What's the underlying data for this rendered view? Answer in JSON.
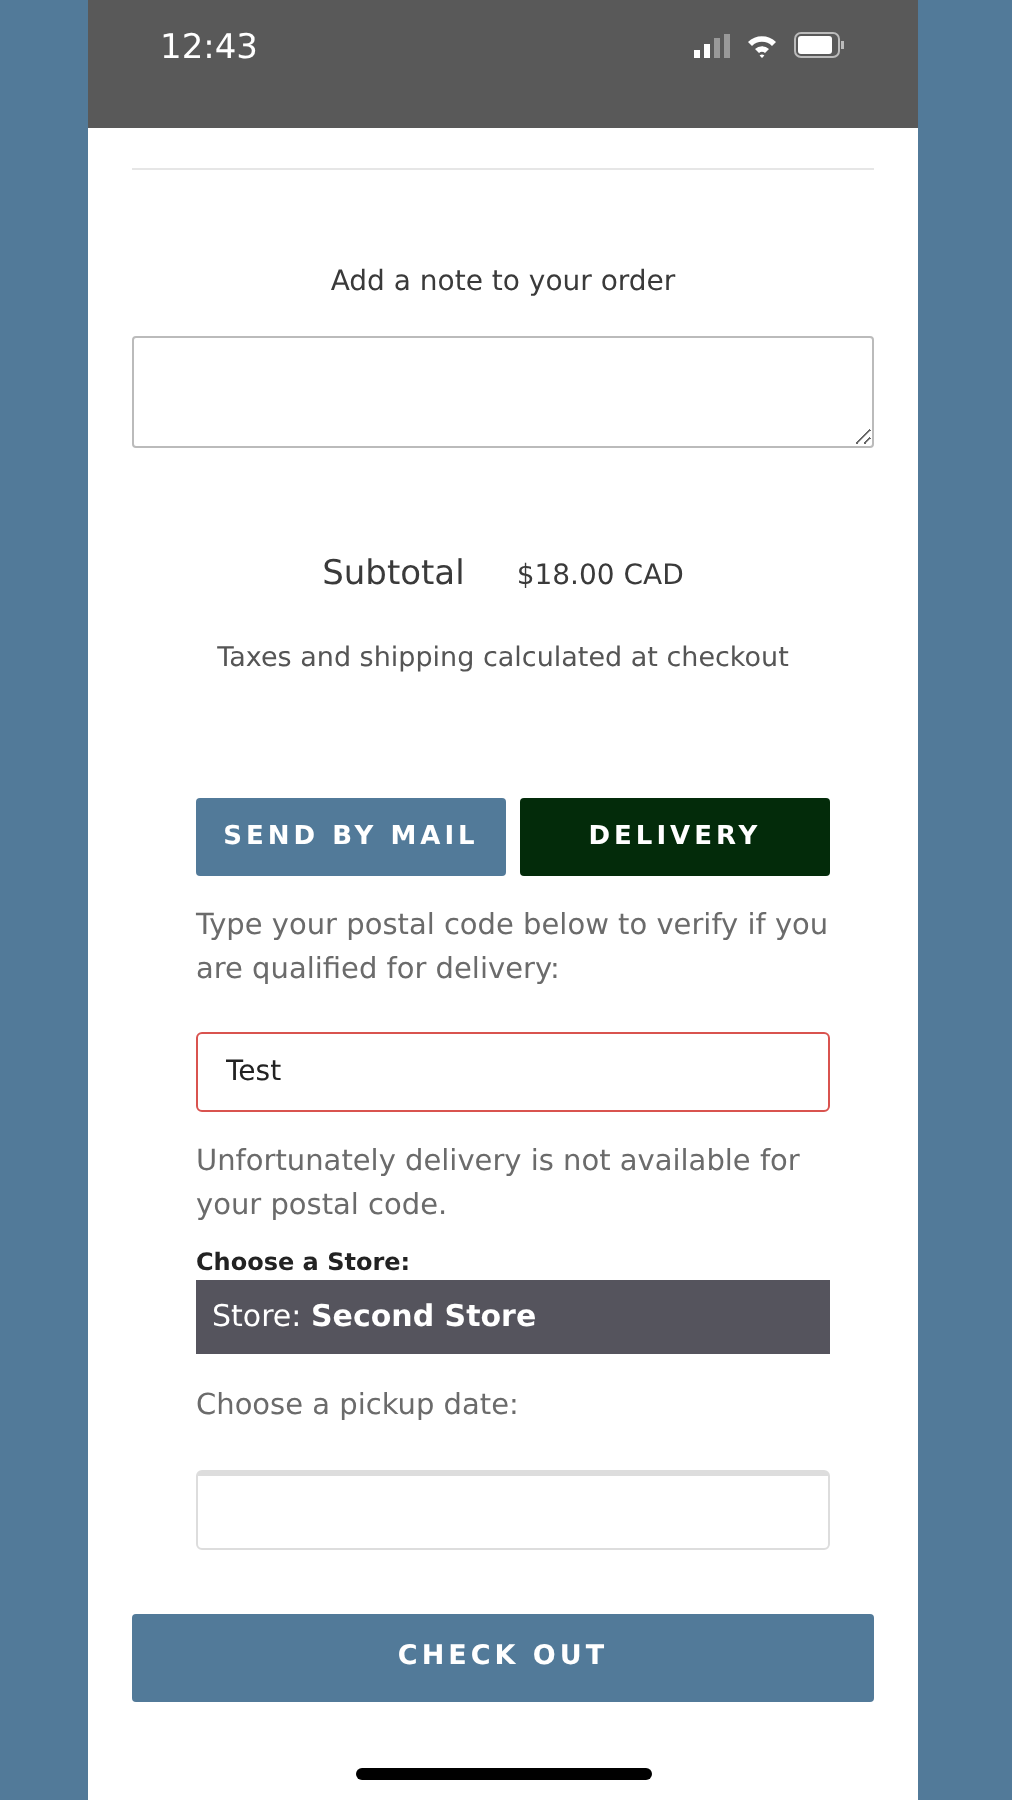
{
  "status_bar": {
    "time": "12:43"
  },
  "note": {
    "label": "Add a note to your order"
  },
  "subtotal": {
    "label": "Subtotal",
    "amount": "$18.00 CAD",
    "note": "Taxes and shipping calculated at checkout"
  },
  "shipping_tabs": [
    {
      "label": "SEND BY MAIL",
      "selected": false
    },
    {
      "label": "DELIVERY",
      "selected": true
    }
  ],
  "postal": {
    "prompt": "Type your postal code below to verify if you are qualified for delivery:",
    "value": "Test",
    "error": true,
    "message": "Unfortunately delivery is not available for your postal code."
  },
  "store": {
    "label": "Choose a Store:",
    "value": "Store: **Second Store**"
  },
  "pickup": {
    "label": "Choose a pickup date:"
  },
  "checkout": {
    "label": "CHECK OUT"
  }
}
